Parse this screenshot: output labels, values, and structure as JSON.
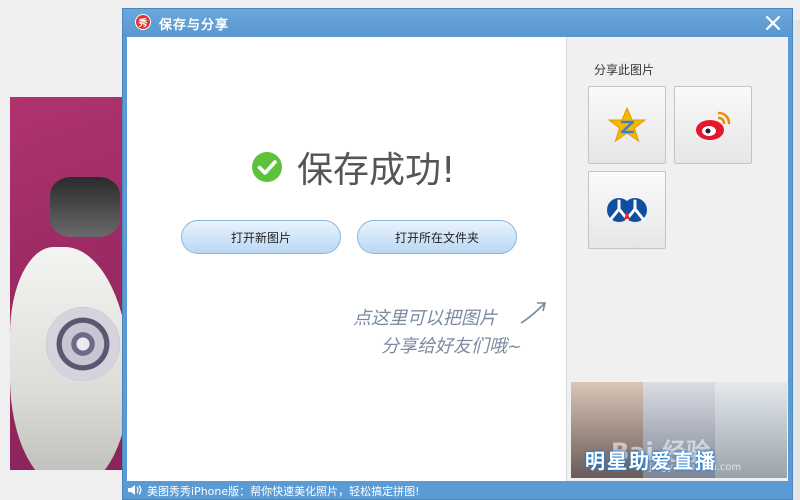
{
  "dialog": {
    "title": "保存与分享",
    "logo_glyph": "秀",
    "close_glyph": "✕"
  },
  "main": {
    "success_text": "保存成功!",
    "buttons": {
      "open_new": "打开新图片",
      "open_folder": "打开所在文件夹"
    },
    "hint": {
      "line1": "点这里可以把图片",
      "line2": "分享给好友们哦~"
    }
  },
  "share": {
    "label": "分享此图片",
    "targets": [
      {
        "icon": "qzone-icon"
      },
      {
        "icon": "weibo-icon"
      },
      {
        "icon": "renren-icon"
      }
    ]
  },
  "ad": {
    "text": "明星助爱直播",
    "watermark": "Bai 经验",
    "watermark_url": "jingyan.baidu.com"
  },
  "statusbar": {
    "text": "美图秀秀iPhone版：帮你快速美化照片，轻松搞定拼图!"
  },
  "colors": {
    "dialog_blue": "#5b9bd5",
    "success_green": "#5cc23a",
    "button_border": "#8ab6e0"
  }
}
